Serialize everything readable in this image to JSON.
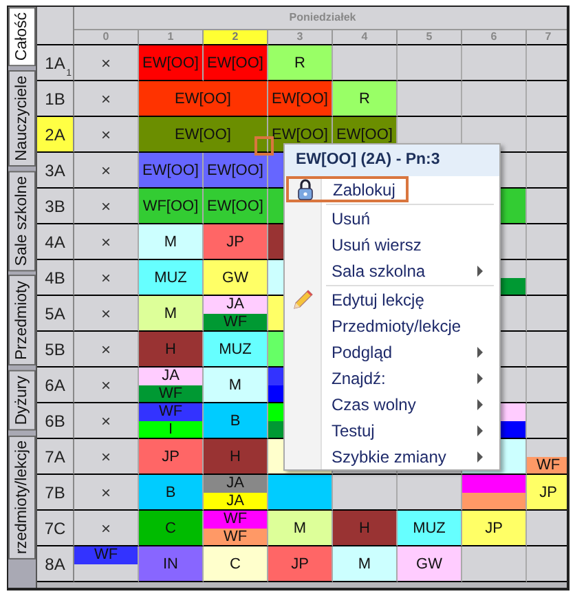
{
  "tabs": [
    {
      "label": "Całość",
      "selected": true
    },
    {
      "label": "Nauczyciele",
      "selected": false
    },
    {
      "label": "Sale szkolne",
      "selected": false
    },
    {
      "label": "Przedmioty",
      "selected": false
    },
    {
      "label": "Dyżury",
      "selected": false
    },
    {
      "label": "rzedmioty/lekcje",
      "selected": false
    }
  ],
  "day": "Poniedziałek",
  "columns": [
    {
      "label": "0",
      "selected": false
    },
    {
      "label": "1",
      "selected": false
    },
    {
      "label": "2",
      "selected": true
    },
    {
      "label": "3",
      "selected": false
    },
    {
      "label": "4",
      "selected": false
    },
    {
      "label": "5",
      "selected": false
    },
    {
      "label": "6",
      "selected": false
    },
    {
      "label": "7",
      "selected": false
    }
  ],
  "rows": [
    {
      "label": "1A",
      "note": "1",
      "selected": false,
      "cells": [
        {
          "parts": [
            {
              "text": "×"
            }
          ]
        },
        {
          "parts": [
            {
              "text": "EW[OO]",
              "color": "#ff0000"
            }
          ]
        },
        {
          "parts": [
            {
              "text": "EW[OO]",
              "color": "#ff0000"
            }
          ]
        },
        {
          "parts": [
            {
              "text": "R",
              "color": "#99ff66"
            }
          ]
        }
      ]
    },
    {
      "label": "1B",
      "selected": false,
      "cells": [
        {
          "parts": [
            {
              "text": "×"
            }
          ]
        },
        {
          "kind": "double",
          "parts": [
            {
              "text": "EW[OO]",
              "color": "#ff3300"
            }
          ]
        },
        {
          "parts": [
            {
              "text": "EW[OO]",
              "color": "#ff3300"
            }
          ]
        },
        {
          "parts": [
            {
              "text": "R",
              "color": "#99ff66"
            }
          ]
        }
      ]
    },
    {
      "label": "2A",
      "selected": true,
      "cells": [
        {
          "parts": [
            {
              "text": "×"
            }
          ]
        },
        {
          "kind": "double",
          "marked": true,
          "parts": [
            {
              "text": "EW[OO]",
              "color": "#6b8e00"
            }
          ]
        },
        {
          "parts": [
            {
              "text": "EW[OO]",
              "color": "#6b8e00"
            }
          ]
        },
        {
          "parts": [
            {
              "text": "EW[OO]",
              "color": "#6b8e00"
            }
          ]
        }
      ]
    },
    {
      "label": "3A",
      "selected": false,
      "cells": [
        {
          "parts": [
            {
              "text": "×"
            }
          ]
        },
        {
          "parts": [
            {
              "text": "EW[OO]",
              "color": "#6666ff"
            }
          ]
        },
        {
          "parts": [
            {
              "text": "EW[OO]",
              "color": "#6666ff"
            }
          ]
        },
        {
          "parts": [
            {
              "color": "#6666ff"
            }
          ]
        }
      ]
    },
    {
      "label": "3B",
      "selected": false,
      "cells": [
        {
          "parts": [
            {
              "text": "×"
            }
          ]
        },
        {
          "parts": [
            {
              "text": "WF[OO]",
              "color": "#33cc33"
            }
          ]
        },
        {
          "parts": [
            {
              "text": "EW[OO]",
              "color": "#33cc33"
            }
          ]
        },
        {
          "parts": [
            {
              "color": "#33cc33"
            }
          ]
        },
        {},
        {},
        {
          "parts": [
            {
              "color": "#33cc33"
            }
          ]
        }
      ]
    },
    {
      "label": "4A",
      "selected": false,
      "cells": [
        {
          "parts": [
            {
              "text": "×"
            }
          ]
        },
        {
          "parts": [
            {
              "text": "M",
              "color": "#ccffff"
            }
          ]
        },
        {
          "parts": [
            {
              "text": "JP",
              "color": "#ff6666"
            }
          ]
        },
        {
          "parts": [
            {
              "color": "#993333"
            }
          ]
        }
      ]
    },
    {
      "label": "4B",
      "selected": false,
      "cells": [
        {
          "parts": [
            {
              "text": "×"
            }
          ]
        },
        {
          "parts": [
            {
              "text": "MUZ",
              "color": "#66ffff"
            }
          ]
        },
        {
          "parts": [
            {
              "text": "GW",
              "color": "#ffff66"
            }
          ]
        },
        {
          "parts": [
            {
              "color": "#ccffff"
            }
          ]
        },
        {},
        {},
        {
          "kind": "lower-half",
          "parts": [
            {
              "color": "#009933"
            }
          ]
        }
      ]
    },
    {
      "label": "5A",
      "selected": false,
      "cells": [
        {
          "parts": [
            {
              "text": "×"
            }
          ]
        },
        {
          "parts": [
            {
              "text": "M",
              "color": "#ddff99"
            }
          ]
        },
        {
          "parts": [
            {
              "text": "JA",
              "color": "#ffccff"
            },
            {
              "text": "WF",
              "color": "#009933"
            }
          ]
        },
        {
          "parts": [
            {
              "color": "#ffff66"
            }
          ]
        }
      ]
    },
    {
      "label": "5B",
      "selected": false,
      "cells": [
        {
          "parts": [
            {
              "text": "×"
            }
          ]
        },
        {
          "parts": [
            {
              "text": "H",
              "color": "#993333"
            }
          ]
        },
        {
          "parts": [
            {
              "text": "MUZ",
              "color": "#66ffff"
            }
          ]
        },
        {
          "parts": [
            {
              "color": "#66ff66"
            }
          ]
        }
      ]
    },
    {
      "label": "6A",
      "selected": false,
      "cells": [
        {
          "parts": [
            {
              "text": "×"
            }
          ]
        },
        {
          "parts": [
            {
              "text": "JA",
              "color": "#ffccff"
            },
            {
              "text": "WF",
              "color": "#009933"
            }
          ]
        },
        {
          "parts": [
            {
              "text": "M",
              "color": "#ccffff"
            }
          ]
        },
        {
          "parts": [
            {
              "color": "#3333ff"
            },
            {
              "color": "#0000ff"
            }
          ]
        }
      ]
    },
    {
      "label": "6B",
      "selected": false,
      "cells": [
        {
          "parts": [
            {
              "text": "×"
            }
          ]
        },
        {
          "parts": [
            {
              "text": "WF",
              "color": "#3333ff"
            },
            {
              "text": "I",
              "color": "#00ff00"
            }
          ]
        },
        {
          "parts": [
            {
              "text": "B",
              "color": "#00ccff"
            }
          ]
        },
        {
          "parts": [
            {
              "color": "#00ff00"
            },
            {
              "color": "#009933"
            }
          ]
        },
        {},
        {},
        {
          "parts": [
            {
              "color": "#ffccff"
            },
            {
              "color": "#0000ff"
            }
          ]
        }
      ]
    },
    {
      "label": "7A",
      "selected": false,
      "cells": [
        {
          "parts": [
            {
              "text": "×"
            }
          ]
        },
        {
          "parts": [
            {
              "text": "JP",
              "color": "#ff6666"
            }
          ]
        },
        {
          "parts": [
            {
              "text": "H",
              "color": "#993333"
            }
          ]
        },
        {
          "parts": [
            {
              "color": "#ffffcc"
            }
          ]
        },
        {},
        {},
        {
          "parts": [
            {
              "color": "#ccffff"
            }
          ]
        },
        {
          "kind": "lower-half",
          "parts": [
            {
              "text": "WF",
              "color": "#ff9966"
            }
          ]
        }
      ]
    },
    {
      "label": "7B",
      "selected": false,
      "cells": [
        {
          "parts": [
            {
              "text": "×"
            }
          ]
        },
        {
          "parts": [
            {
              "text": "B",
              "color": "#00ccff"
            }
          ]
        },
        {
          "parts": [
            {
              "text": "JA",
              "color": "#888888"
            },
            {
              "text": "JA",
              "color": "#ffff00"
            }
          ]
        },
        {
          "parts": [
            {
              "color": "#00ccff"
            }
          ]
        },
        {},
        {},
        {
          "parts": [
            {
              "color": "#ff00ff"
            },
            {
              "color": "#ff9966"
            }
          ]
        },
        {
          "parts": [
            {
              "text": "JP",
              "color": "#ffff66"
            }
          ]
        }
      ]
    },
    {
      "label": "7C",
      "selected": false,
      "cells": [
        {
          "parts": [
            {
              "text": "×"
            }
          ]
        },
        {
          "parts": [
            {
              "text": "C",
              "color": "#00bb00"
            }
          ]
        },
        {
          "parts": [
            {
              "text": "WF",
              "color": "#ff00ff"
            },
            {
              "text": "WF",
              "color": "#ff9966"
            }
          ]
        },
        {
          "parts": [
            {
              "text": "M",
              "color": "#ddff99"
            }
          ]
        },
        {
          "parts": [
            {
              "text": "H",
              "color": "#993333"
            }
          ]
        },
        {
          "parts": [
            {
              "text": "MUZ",
              "color": "#66ffff"
            }
          ]
        },
        {
          "parts": [
            {
              "text": "JP",
              "color": "#ffff66"
            }
          ]
        }
      ]
    },
    {
      "label": "8A",
      "selected": false,
      "cells": [
        {
          "kind": "upper-half",
          "parts": [
            {
              "text": "WF",
              "color": "#3333ff"
            }
          ]
        },
        {
          "parts": [
            {
              "text": "IN",
              "color": "#8866ff"
            }
          ]
        },
        {
          "parts": [
            {
              "text": "C",
              "color": "#ffffcc"
            }
          ]
        },
        {
          "parts": [
            {
              "text": "JP",
              "color": "#ff6666"
            }
          ]
        },
        {
          "parts": [
            {
              "text": "M",
              "color": "#ccffff"
            }
          ]
        },
        {
          "parts": [
            {
              "text": "GW",
              "color": "#ffccff"
            }
          ]
        }
      ]
    }
  ],
  "menu": {
    "title": "EW[OO] (2A) - Pn:3",
    "items": [
      {
        "label": "Zablokuj",
        "kind": "lock",
        "highlighted": true,
        "separator_after": true
      },
      {
        "label": "Usuń",
        "kind": "plain",
        "highlighted": false
      },
      {
        "label": "Usuń wiersz",
        "kind": "plain",
        "highlighted": false
      },
      {
        "label": "Sala szkolna",
        "kind": "plain",
        "submenu": true,
        "highlighted": false,
        "separator_after": true
      },
      {
        "label": "Edytuj lekcję",
        "kind": "edit",
        "highlighted": false
      },
      {
        "label": "Przedmioty/lekcje",
        "kind": "plain",
        "highlighted": false
      },
      {
        "label": "Podgląd",
        "kind": "plain",
        "submenu": true,
        "highlighted": false
      },
      {
        "label": "Znajdź:",
        "kind": "plain",
        "submenu": true,
        "highlighted": false
      },
      {
        "label": "Czas wolny",
        "kind": "plain",
        "submenu": true,
        "highlighted": false
      },
      {
        "label": "Testuj",
        "kind": "plain",
        "submenu": true,
        "highlighted": false
      },
      {
        "label": "Szybkie zmiany",
        "kind": "plain",
        "submenu": true,
        "highlighted": false
      }
    ]
  }
}
